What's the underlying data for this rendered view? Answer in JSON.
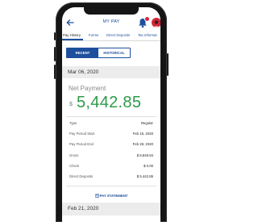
{
  "header": {
    "title": "MY PAY",
    "back_icon": "arrow-left-icon",
    "bell_icon": "bell-icon",
    "avatar_icon": "user-avatar"
  },
  "tabs": [
    {
      "label": "Pay History",
      "active": true
    },
    {
      "label": "Forms",
      "active": false
    },
    {
      "label": "Direct Deposits",
      "active": false
    },
    {
      "label": "Tax Informat",
      "active": false
    }
  ],
  "segment": {
    "recent_label": "RECENT",
    "historical_label": "HISTORICAL",
    "selected": "RECENT"
  },
  "payments": [
    {
      "date": "Mar 06, 2020",
      "net_label": "Net Payment",
      "currency": "$",
      "net_amount": "5,442.85",
      "details": [
        {
          "label": "Type",
          "value": "Regular"
        },
        {
          "label": "Pay Period Start",
          "value": "Feb 15, 2020"
        },
        {
          "label": "Pay Period End",
          "value": "Feb 28, 2020"
        },
        {
          "label": "Gross",
          "value": "$ 8,848.94"
        },
        {
          "label": "Check",
          "value": "$ 0.00"
        },
        {
          "label": "Direct Deposits",
          "value": "$ 5,442.85"
        }
      ],
      "statement_label": "PAY STATEMENT"
    },
    {
      "date": "Feb 21, 2020"
    }
  ],
  "colors": {
    "brand_blue": "#1e4f9c",
    "amount_green": "#2e9a4a",
    "badge_red": "#d4263b"
  }
}
